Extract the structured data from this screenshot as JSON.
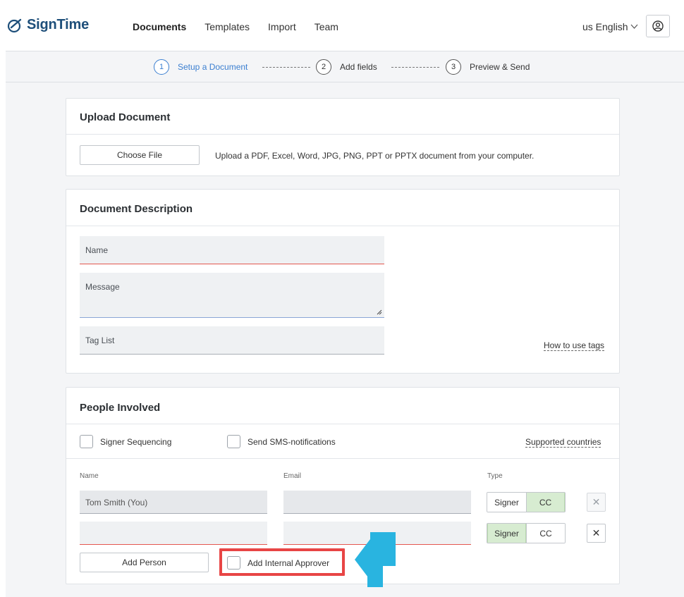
{
  "app": {
    "logo_text": "SignTime"
  },
  "nav": {
    "items": [
      {
        "label": "Documents",
        "active": true
      },
      {
        "label": "Templates",
        "active": false
      },
      {
        "label": "Import",
        "active": false
      },
      {
        "label": "Team",
        "active": false
      }
    ],
    "language": "us English"
  },
  "stepper": {
    "steps": [
      {
        "number": "1",
        "label": "Setup a Document",
        "current": true
      },
      {
        "number": "2",
        "label": "Add fields",
        "current": false
      },
      {
        "number": "3",
        "label": "Preview & Send",
        "current": false
      }
    ]
  },
  "upload": {
    "title": "Upload Document",
    "choose_file_label": "Choose File",
    "hint": "Upload a PDF, Excel, Word, JPG, PNG, PPT or PPTX document from your computer."
  },
  "description": {
    "title": "Document Description",
    "name_placeholder": "Name",
    "message_placeholder": "Message",
    "tag_placeholder": "Tag List",
    "tags_help_link": "How to use tags"
  },
  "people": {
    "title": "People Involved",
    "signer_sequencing_label": "Signer Sequencing",
    "sms_label": "Send SMS-notifications",
    "supported_countries_link": "Supported countries",
    "columns": {
      "name": "Name",
      "email": "Email",
      "type": "Type"
    },
    "rows": [
      {
        "name": "Tom Smith (You)",
        "email": "",
        "type_signer": "Signer",
        "type_cc": "CC",
        "selected": "CC"
      },
      {
        "name": "",
        "email": "",
        "type_signer": "Signer",
        "type_cc": "CC",
        "selected": "Signer"
      }
    ],
    "add_person_label": "Add Person",
    "add_internal_approver_label": "Add Internal Approver"
  },
  "colors": {
    "brand": "#1e4f7a",
    "accent_step": "#3b7fd0",
    "highlight": "#e84545",
    "arrow": "#29b4e0",
    "selected_type": "#d7ecd1"
  }
}
